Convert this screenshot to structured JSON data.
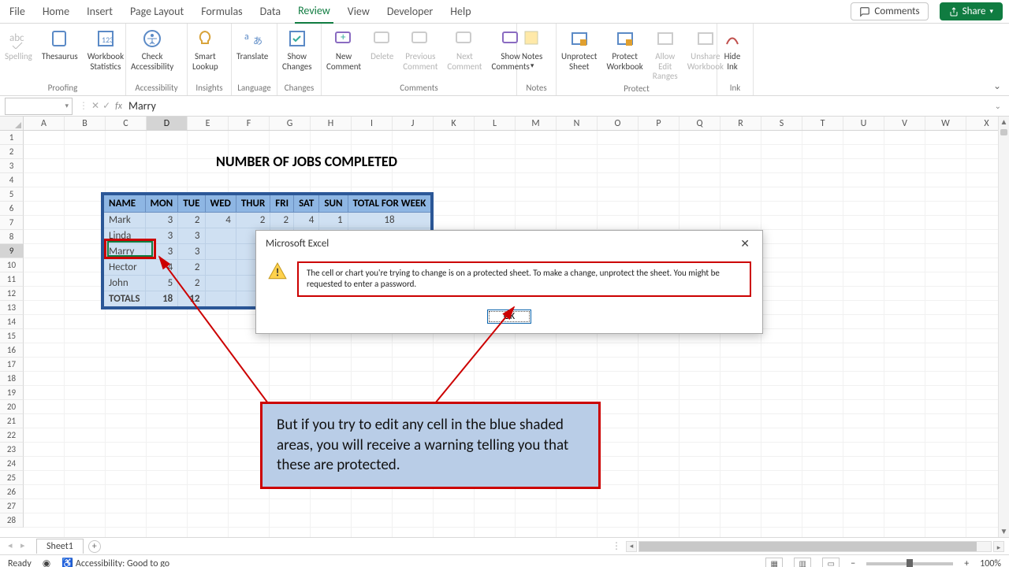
{
  "tabs": {
    "file": "File",
    "home": "Home",
    "insert": "Insert",
    "page": "Page Layout",
    "formulas": "Formulas",
    "data": "Data",
    "review": "Review",
    "view": "View",
    "developer": "Developer",
    "help": "Help"
  },
  "topright": {
    "comments": "Comments",
    "share": "Share"
  },
  "ribbon": {
    "proofing": {
      "label": "Proofing",
      "spelling": "Spelling",
      "thesaurus": "Thesaurus",
      "stats": "Workbook\nStatistics"
    },
    "accessibility": {
      "label": "Accessibility",
      "check": "Check\nAccessibility"
    },
    "insights": {
      "label": "Insights",
      "smart": "Smart\nLookup"
    },
    "language": {
      "label": "Language",
      "translate": "Translate"
    },
    "changes": {
      "label": "Changes",
      "show": "Show\nChanges"
    },
    "commentsGrp": {
      "label": "Comments",
      "new": "New\nComment",
      "delete": "Delete",
      "prev": "Previous\nComment",
      "next": "Next\nComment",
      "show": "Show\nComments"
    },
    "notes": {
      "label": "Notes",
      "notes": "Notes"
    },
    "protect": {
      "label": "Protect",
      "unprotect": "Unprotect\nSheet",
      "workbook": "Protect\nWorkbook",
      "ranges": "Allow Edit\nRanges",
      "unshare": "Unshare\nWorkbook"
    },
    "ink": {
      "label": "Ink",
      "hide": "Hide\nInk"
    }
  },
  "formula_bar": {
    "name_box": "",
    "value": "Marry"
  },
  "columns": [
    "A",
    "B",
    "C",
    "D",
    "E",
    "F",
    "G",
    "H",
    "I",
    "J",
    "K",
    "L",
    "M",
    "N",
    "O",
    "P",
    "Q",
    "R",
    "S",
    "T",
    "U",
    "V",
    "W",
    "X"
  ],
  "row_count": 28,
  "selected_row": 9,
  "selected_col": "D",
  "title": "NUMBER OF JOBS COMPLETED",
  "table": {
    "headers": [
      "NAME",
      "MON",
      "TUE",
      "WED",
      "THUR",
      "FRI",
      "SAT",
      "SUN",
      "TOTAL FOR WEEK"
    ],
    "rows": [
      [
        "Mark",
        "3",
        "2",
        "4",
        "2",
        "2",
        "4",
        "1",
        "18"
      ],
      [
        "Linda",
        "3",
        "3",
        "",
        "",
        "",
        "",
        "",
        ""
      ],
      [
        "Marry",
        "3",
        "3",
        "",
        "",
        "",
        "",
        "",
        ""
      ],
      [
        "Hector",
        "4",
        "2",
        "",
        "",
        "",
        "",
        "",
        ""
      ],
      [
        "John",
        "5",
        "2",
        "",
        "",
        "",
        "",
        "",
        ""
      ]
    ],
    "totals": [
      "TOTALS",
      "18",
      "12",
      "",
      "",
      "",
      "",
      "",
      ""
    ]
  },
  "dialog": {
    "title": "Microsoft Excel",
    "msg": "The cell or chart you're trying to change is on a protected sheet. To make a change, unprotect the sheet. You might be requested to enter a password.",
    "ok": "OK"
  },
  "callout": "But if you try to edit any cell in the blue shaded areas, you will receive a warning telling you that these are protected.",
  "sheet_tab": "Sheet1",
  "status": {
    "ready": "Ready",
    "acc": "Accessibility: Good to go",
    "zoom": "100%"
  }
}
